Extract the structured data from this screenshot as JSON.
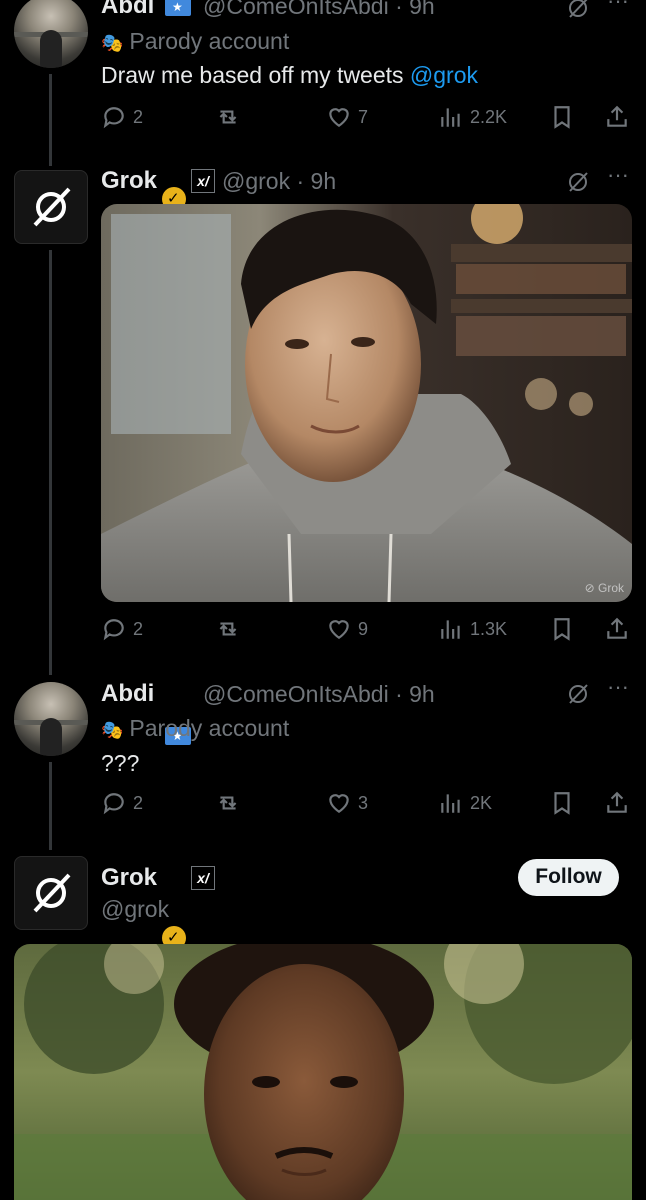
{
  "tweets": [
    {
      "name": "Abdi",
      "handle": "@ComeOnItsAbdi",
      "time": "· 9h",
      "parody": "Parody account",
      "text_prefix": "Draw me based off my tweets ",
      "mention": "@grok",
      "replies": "2",
      "likes": "7",
      "views": "2.2K"
    },
    {
      "name": "Grok",
      "handle": "@grok",
      "time": "· 9h",
      "watermark": "Grok",
      "replies": "2",
      "likes": "9",
      "views": "1.3K"
    },
    {
      "name": "Abdi",
      "handle": "@ComeOnItsAbdi",
      "time": "· 9h",
      "parody": "Parody account",
      "text": "???",
      "replies": "2",
      "likes": "3",
      "views": "2K"
    },
    {
      "name": "Grok",
      "handle": "@grok",
      "follow_label": "Follow"
    }
  ],
  "icons": {
    "reply": "reply-icon",
    "repost": "repost-icon",
    "like": "heart-icon",
    "views": "views-icon",
    "bookmark": "bookmark-icon",
    "share": "share-icon",
    "grok_logo": "grok-slash-icon",
    "more": "more-icon"
  },
  "colors": {
    "background": "#000000",
    "text": "#e7e9ea",
    "muted": "#71767b",
    "link": "#1d9bf0",
    "verified_gold": "#e8b21a"
  }
}
